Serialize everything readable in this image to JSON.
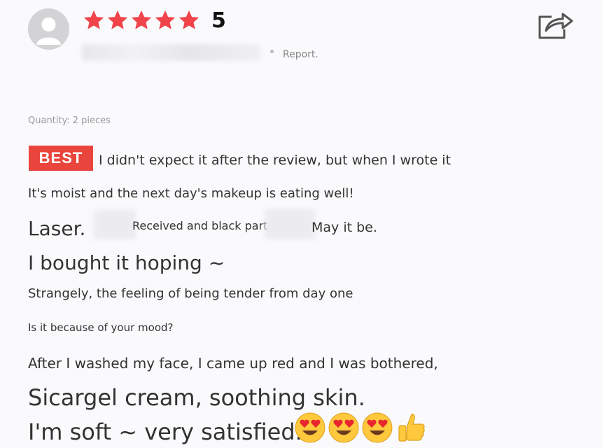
{
  "review": {
    "rating_value": "5",
    "stars_filled": 5,
    "stars_total": 5,
    "star_color": "#f0444a",
    "report_label": "Report.",
    "quantity": "Quantity: 2 pieces",
    "badge": "BEST",
    "badge_color": "#e9453d",
    "body": {
      "line1": "I didn't expect it after the review, but when I wrote it",
      "line2": "It's moist and the next day's makeup is eating well!",
      "line3a": "Laser.",
      "line3b": "Received and black part",
      "line3c": "May it be.",
      "line4": "I bought it hoping ~",
      "line5": "Strangely, the feeling of being tender from day one",
      "line6": "Is it because of your mood?",
      "line7": "After I washed my face, I came up red and I was bothered,",
      "line8": "Sicargel cream, soothing skin.",
      "line9": "I'm soft ~ very satisfied."
    },
    "emojis": [
      "heart-eyes-emoji",
      "heart-eyes-emoji",
      "heart-eyes-emoji",
      "thumbs-up-emoji"
    ]
  },
  "icons": {
    "avatar": "default-user-avatar-icon",
    "share": "share-icon",
    "star": "star-icon"
  }
}
